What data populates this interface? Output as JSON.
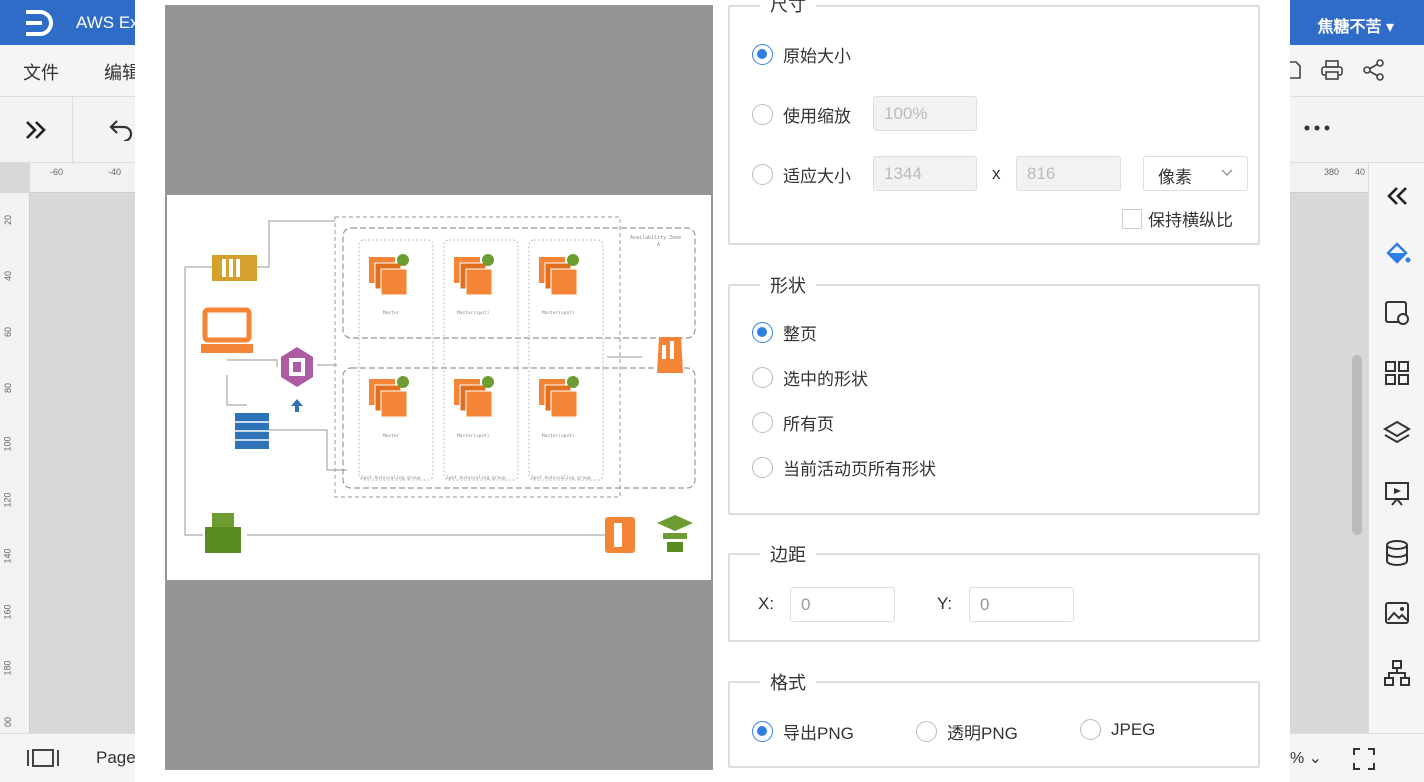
{
  "app": {
    "title": "AWS Ex",
    "user": "焦糖不苦",
    "menu": [
      "文件",
      "编辑"
    ],
    "ruler_top": [
      "-60",
      "-40",
      "380",
      "40"
    ],
    "ruler_left": [
      "20",
      "40",
      "60",
      "80",
      "100",
      "120",
      "140",
      "160",
      "180",
      "00"
    ],
    "page_label": "Page",
    "zoom_suffix": "%"
  },
  "dialog": {
    "size": {
      "legend": "尺寸",
      "opt_original": "原始大小",
      "opt_scale": "使用缩放",
      "scale_value": "100%",
      "opt_fit": "适应大小",
      "width": "1344",
      "x_sep": "x",
      "height": "816",
      "unit": "像素",
      "keep_ratio": "保持横纵比"
    },
    "shape": {
      "legend": "形状",
      "opt_page": "整页",
      "opt_selected": "选中的形状",
      "opt_all": "所有页",
      "opt_active": "当前活动页所有形状"
    },
    "margin": {
      "legend": "边距",
      "x_label": "X:",
      "x_value": "0",
      "y_label": "Y:",
      "y_value": "0"
    },
    "format": {
      "legend": "格式",
      "opt_png": "导出PNG",
      "opt_transparent": "透明PNG",
      "opt_jpeg": "JPEG"
    }
  },
  "diagram": {
    "az_label": "Availability Zone",
    "az_num": "A",
    "node_a": "Master",
    "node_b": "Master(spot)",
    "group_label": "Spot Autoscaling group"
  },
  "colors": {
    "accent": "#2f7ee3",
    "titlebar": "#2f6cc8",
    "aws_orange": "#f58536",
    "aws_green": "#6d9c33",
    "aws_purple": "#ad5ba3",
    "aws_blue": "#2e73b8",
    "aws_gold": "#d6a02c"
  }
}
